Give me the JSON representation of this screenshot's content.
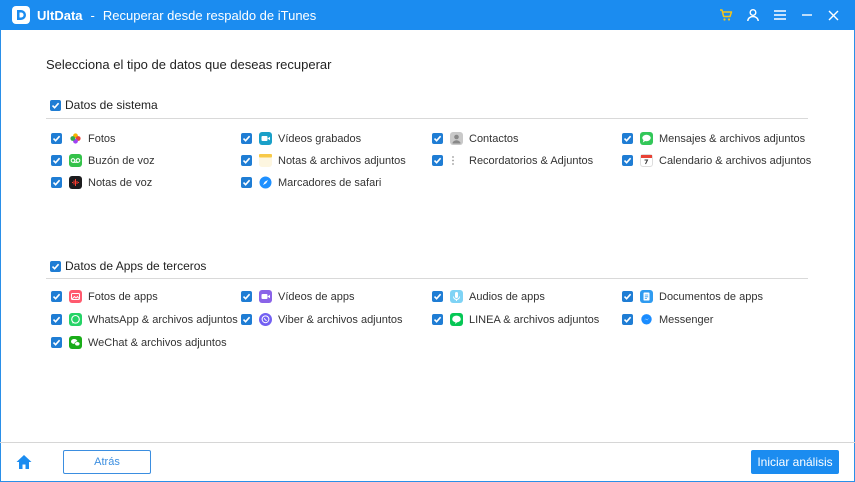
{
  "titlebar": {
    "brand": "UltData",
    "separator": "-",
    "title": "Recuperar desde respaldo de iTunes"
  },
  "heading": "Selecciona el tipo de datos que deseas recuperar",
  "system": {
    "label": "Datos de sistema",
    "items": [
      {
        "label": "Fotos",
        "icon": "photos-icon",
        "checked": true
      },
      {
        "label": "Vídeos grabados",
        "icon": "videos-icon",
        "checked": true
      },
      {
        "label": "Contactos",
        "icon": "contacts-icon",
        "checked": true
      },
      {
        "label": "Mensajes & archivos adjuntos",
        "icon": "messages-icon",
        "checked": true
      },
      {
        "label": "Buzón de voz",
        "icon": "voicemail-icon",
        "checked": true
      },
      {
        "label": "Notas & archivos adjuntos",
        "icon": "notes-icon",
        "checked": true
      },
      {
        "label": "Recordatorios & Adjuntos",
        "icon": "reminders-icon",
        "checked": true
      },
      {
        "label": "Calendario & archivos adjuntos",
        "icon": "calendar-icon",
        "checked": true
      },
      {
        "label": "Notas de voz",
        "icon": "voice-memos-icon",
        "checked": true
      },
      {
        "label": "Marcadores de safari",
        "icon": "safari-icon",
        "checked": true
      }
    ]
  },
  "third_party": {
    "label": "Datos de Apps de terceros",
    "items": [
      {
        "label": "Fotos de apps",
        "icon": "app-photos-icon",
        "checked": true
      },
      {
        "label": "Vídeos de apps",
        "icon": "app-videos-icon",
        "checked": true
      },
      {
        "label": "Audios de apps",
        "icon": "app-audio-icon",
        "checked": true
      },
      {
        "label": "Documentos de apps",
        "icon": "app-documents-icon",
        "checked": true
      },
      {
        "label": "WhatsApp & archivos adjuntos",
        "icon": "whatsapp-icon",
        "checked": true
      },
      {
        "label": "Viber & archivos adjuntos",
        "icon": "viber-icon",
        "checked": true
      },
      {
        "label": "LINEA & archivos adjuntos",
        "icon": "line-icon",
        "checked": true
      },
      {
        "label": "Messenger",
        "icon": "messenger-icon",
        "checked": true
      },
      {
        "label": "WeChat & archivos adjuntos",
        "icon": "wechat-icon",
        "checked": true
      }
    ]
  },
  "footer": {
    "back_label": "Atrás",
    "start_label": "Iniciar análisis"
  },
  "colors": {
    "accent": "#1b8cf0",
    "checkbox": "#1f7dd4",
    "cart": "#f5c518"
  }
}
